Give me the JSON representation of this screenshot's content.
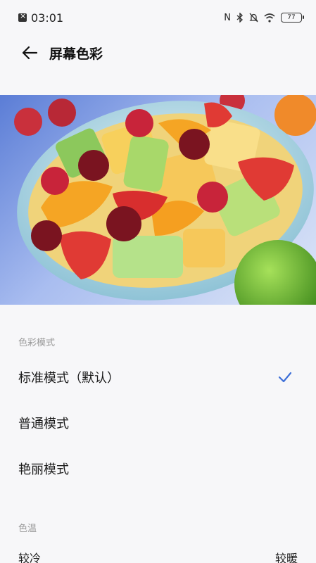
{
  "status_bar": {
    "time": "03:01",
    "battery": "77",
    "icons": [
      "notification-icon",
      "nfc-icon",
      "bluetooth-icon",
      "mute-icon",
      "wifi-icon",
      "battery-icon"
    ]
  },
  "header": {
    "title": "屏幕色彩",
    "back_icon": "arrow-left-icon"
  },
  "preview": {
    "image_subject": "fruit-salad-bowl"
  },
  "color_mode": {
    "section_label": "色彩模式",
    "options": [
      {
        "label": "标准模式（默认）",
        "selected": true
      },
      {
        "label": "普通模式",
        "selected": false
      },
      {
        "label": "艳丽模式",
        "selected": false
      }
    ]
  },
  "color_temperature": {
    "section_label": "色温",
    "left_label": "较冷",
    "right_label": "较暖"
  },
  "colors": {
    "accent": "#3d6fd8",
    "background": "#f7f7f9",
    "secondary_text": "#9a9a9a"
  }
}
